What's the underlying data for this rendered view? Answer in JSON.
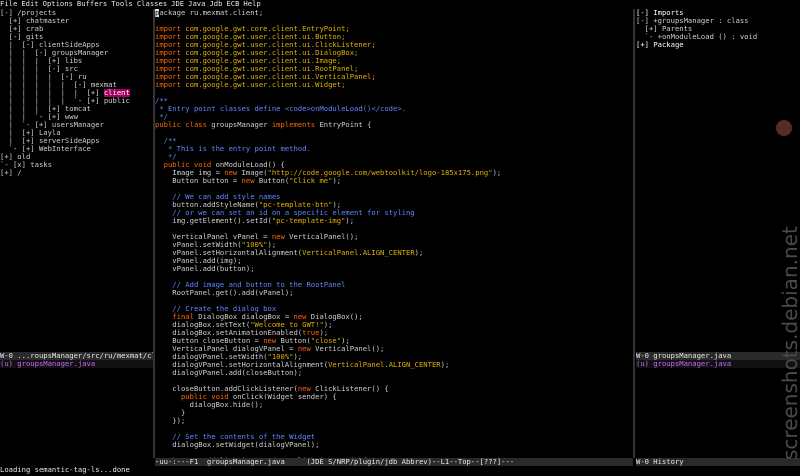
{
  "menubar": [
    "File",
    "Edit",
    "Options",
    "Buffers",
    "Tools",
    "Classes",
    "JDE",
    "Java",
    "Jdb",
    "ECB",
    "Help"
  ],
  "left_tree": [
    "[-] /projects",
    "  [+] chatmaster",
    "  [+] crab",
    "  [-] gits",
    "  |  [-] clientSideApps",
    "  |  |  [-] groupsManager",
    "  |  |  |  [+] libs",
    "  |  |  |  [-] src",
    "  |  |  |  |  [-] ru",
    "  |  |  |  |  |  [-] mexmat",
    "  |  |  |  |  |  |  [+] client",
    "  |  |  |  |  |  `- [+] public",
    "  |  |  |  [+] tomcat",
    "  |  |  `- [+] www",
    "  |  `- [+] usersManager",
    "  |  [+] Layla",
    "  |  [+] serverSideApps",
    "  `- [+] WebInterface",
    "[+] old",
    "`- [x] tasks",
    "[+] /"
  ],
  "left_modeline": "W-0 ...roupsManager/src/ru/mexmat/client",
  "left_buffer": "(u) groupsManager.java",
  "code": [
    "package ru.mexmat.client;",
    "",
    "import com.google.gwt.core.client.EntryPoint;",
    "import com.google.gwt.user.client.ui.Button;",
    "import com.google.gwt.user.client.ui.ClickListener;",
    "import com.google.gwt.user.client.ui.DialogBox;",
    "import com.google.gwt.user.client.ui.Image;",
    "import com.google.gwt.user.client.ui.RootPanel;",
    "import com.google.gwt.user.client.ui.VerticalPanel;",
    "import com.google.gwt.user.client.ui.Widget;",
    "",
    "/**",
    " * Entry point classes define <code>onModuleLoad()</code>.",
    " */",
    "public class groupsManager implements EntryPoint {",
    "",
    "  /**",
    "   * This is the entry point method.",
    "   */",
    "  public void onModuleLoad() {",
    "    Image img = new Image(\"http://code.google.com/webtoolkit/logo-185x175.png\");",
    "    Button button = new Button(\"Click me\");",
    "",
    "    // We can add style names",
    "    button.addStyleName(\"pc-template-btn\");",
    "    // or we can set an id on a specific element for styling",
    "    img.getElement().setId(\"pc-template-img\");",
    "",
    "    VerticalPanel vPanel = new VerticalPanel();",
    "    vPanel.setWidth(\"100%\");",
    "    vPanel.setHorizontalAlignment(VerticalPanel.ALIGN_CENTER);",
    "    vPanel.add(img);",
    "    vPanel.add(button);",
    "",
    "    // Add image and button to the RootPanel",
    "    RootPanel.get().add(vPanel);",
    "",
    "    // Create the dialog box",
    "    final DialogBox dialogBox = new DialogBox();",
    "    dialogBox.setText(\"Welcome to GWT!\");",
    "    dialogBox.setAnimationEnabled(true);",
    "    Button closeButton = new Button(\"close\");",
    "    VerticalPanel dialogVPanel = new VerticalPanel();",
    "    dialogVPanel.setWidth(\"100%\");",
    "    dialogVPanel.setHorizontalAlignment(VerticalPanel.ALIGN_CENTER);",
    "    dialogVPanel.add(closeButton);",
    "",
    "    closeButton.addClickListener(new ClickListener() {",
    "      public void onClick(Widget sender) {",
    "        dialogBox.hide();",
    "      }",
    "    });",
    "",
    "    // Set the contents of the Widget",
    "    dialogBox.setWidget(dialogVPanel);",
    "",
    "    button.addClickListener(new ClickListener() {",
    "      public void onClick(Widget sender) {",
    "        dialogBox.center();",
    "        dialogBox.show();"
  ],
  "mid_modeline": "-uu-:---F1  groupsManager.java     (JDE S/NRP/plugin/jdb Abbrev)--L1--Top--[???]---",
  "right_tree": [
    "[-] Imports",
    "[-] +groupsManager : class",
    "  [+] Parents",
    "  `- +onModuleLoad () : void",
    "[+] Package"
  ],
  "right_modeline": "W-0 groupsManager.java",
  "right_buffer": "(u) groupsManager.java",
  "right_bottom_modeline": "W-0 History",
  "echo": "Loading semantic-tag-ls...done",
  "watermark": "screenshots.debian.net",
  "colors": {
    "keyword": "#ff6600",
    "string": "#e0b000",
    "comment": "#5f87ff",
    "highlight": "#a0005f"
  }
}
